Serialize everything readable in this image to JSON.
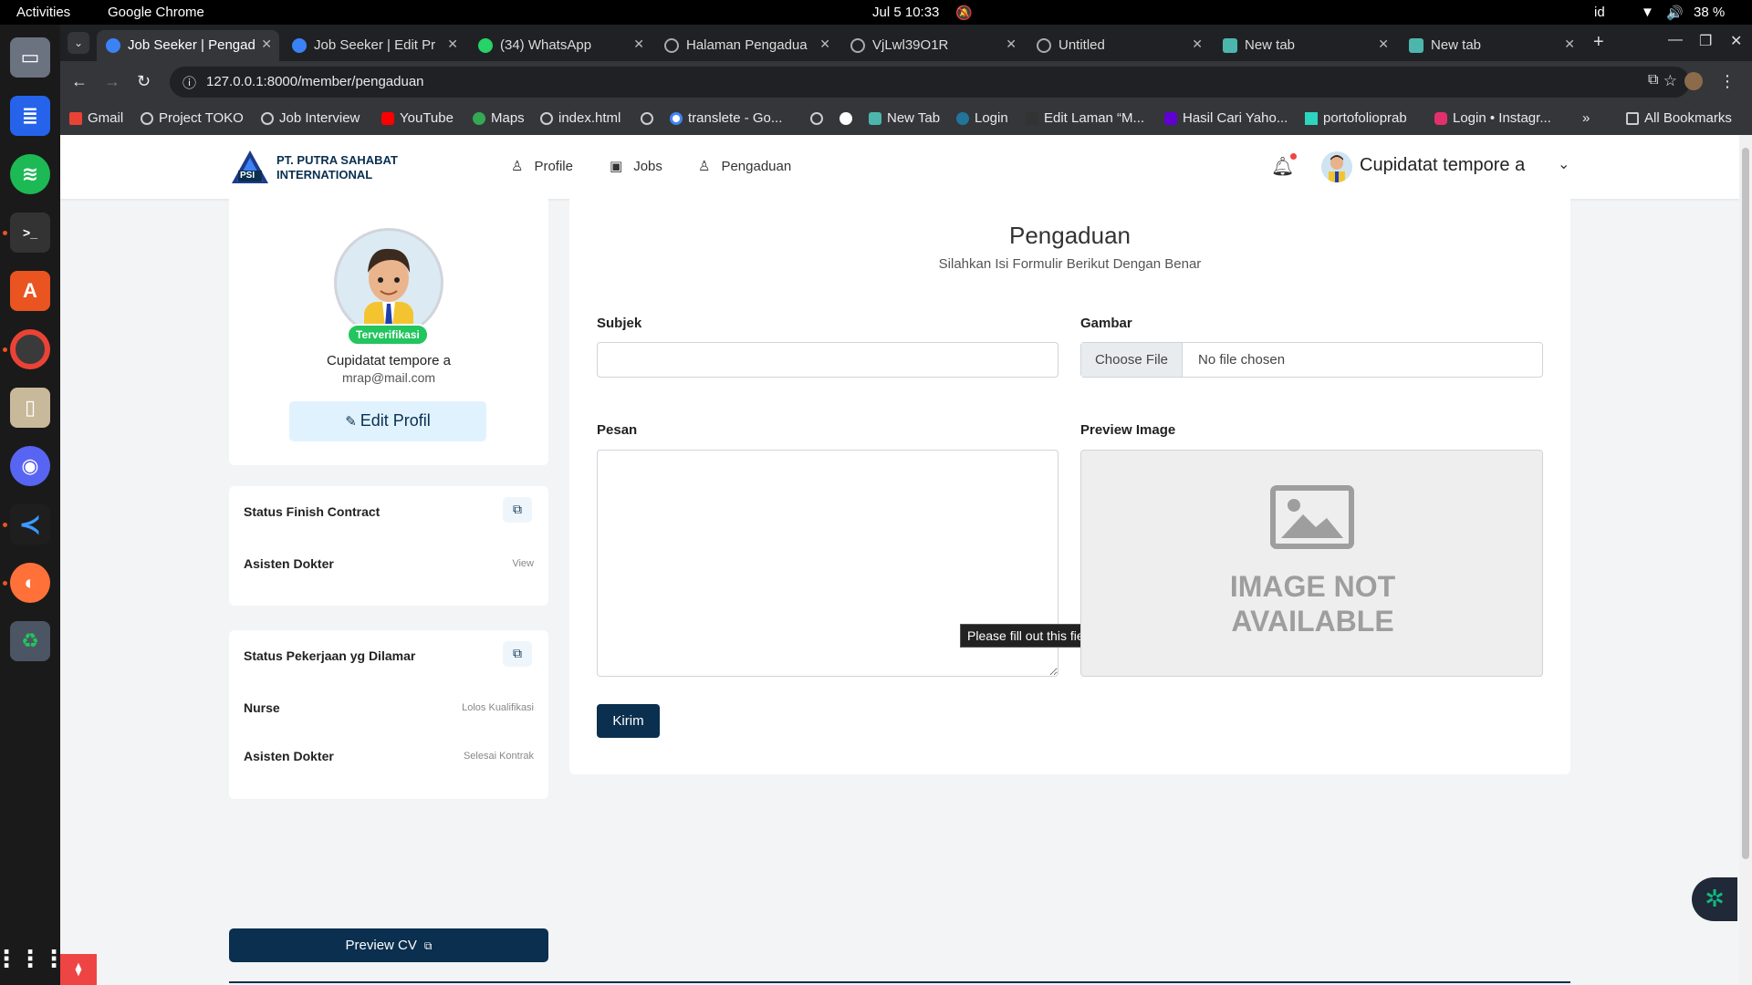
{
  "system_bar": {
    "activities": "Activities",
    "app": "Google Chrome",
    "clock": "Jul 5  10:33",
    "lang": "id",
    "battery": "38 %"
  },
  "tabs": [
    {
      "title": "Job Seeker | Pengaduan",
      "active": true
    },
    {
      "title": "Job Seeker | Edit Pr",
      "active": false
    },
    {
      "title": "(34) WhatsApp",
      "active": false
    },
    {
      "title": "Halaman Pengadua",
      "active": false
    },
    {
      "title": "VjLwl39O1R",
      "active": false
    },
    {
      "title": "Untitled",
      "active": false
    },
    {
      "title": "New tab",
      "active": false
    },
    {
      "title": "New tab",
      "active": false
    }
  ],
  "url": "127.0.0.1:8000/member/pengaduan",
  "bookmarks": [
    "Gmail",
    "Project TOKO",
    "Job Interview",
    "YouTube",
    "Maps",
    "index.html",
    "",
    "translete - Go...",
    "",
    "",
    "New Tab",
    "Login",
    "Edit Laman “M...",
    "Hasil Cari Yaho...",
    "portofolioprab",
    "Login • Instagr..."
  ],
  "bookmarks_more": "»",
  "all_bookmarks": "All Bookmarks",
  "brand": {
    "line1": "PT. PUTRA SAHABAT",
    "line2": "INTERNATIONAL",
    "logo_text": "PSI"
  },
  "nav": {
    "profile": "Profile",
    "jobs": "Jobs",
    "pengaduan": "Pengaduan"
  },
  "user": {
    "name": "Cupidatat tempore a",
    "email": "mrap@mail.com",
    "badge": "Terverifikasi"
  },
  "profile_card": {
    "edit_label": "Edit Profil"
  },
  "finish_contract": {
    "title": "Status Finish Contract",
    "items": [
      {
        "name": "Asisten Dokter",
        "status": "View"
      }
    ]
  },
  "applied_jobs": {
    "title": "Status Pekerjaan yg Dilamar",
    "items": [
      {
        "name": "Nurse",
        "status": "Lolos Kualifikasi"
      },
      {
        "name": "Asisten Dokter",
        "status": "Selesai Kontrak"
      }
    ]
  },
  "preview_cv": "Preview CV",
  "form": {
    "title": "Pengaduan",
    "subtitle": "Silahkan Isi Formulir Berikut Dengan Benar",
    "subject_label": "Subjek",
    "subject_value": "",
    "image_label": "Gambar",
    "choose_file": "Choose File",
    "no_file": "No file chosen",
    "message_label": "Pesan",
    "message_value": "",
    "preview_label": "Preview Image",
    "image_na_line1": "IMAGE NOT",
    "image_na_line2": "AVAILABLE",
    "submit": "Kirim",
    "tooltip": "Please fill out this field."
  },
  "colors": {
    "primary": "#0a2f4f",
    "badge": "#22c55e",
    "edit_bg": "#e0f2fe"
  }
}
